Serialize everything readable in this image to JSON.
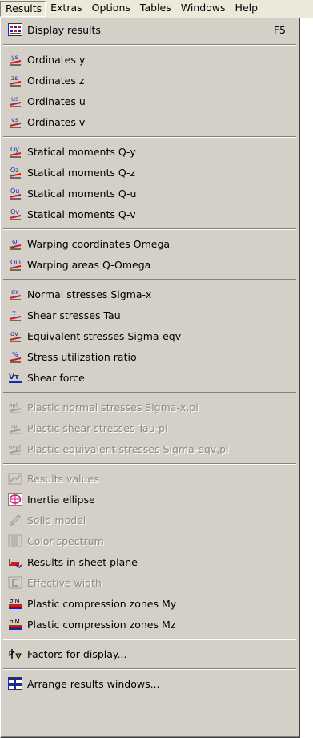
{
  "menubar": {
    "items": [
      "Results",
      "Extras",
      "Options",
      "Tables",
      "Windows",
      "Help"
    ]
  },
  "menu": {
    "items": [
      {
        "label": "Display results",
        "shortcut": "F5",
        "icon": "display-results-icon"
      },
      {
        "label": "Ordinates y",
        "icon": "ordinate-y-icon"
      },
      {
        "label": "Ordinates z",
        "icon": "ordinate-z-icon"
      },
      {
        "label": "Ordinates u",
        "icon": "ordinate-u-icon"
      },
      {
        "label": "Ordinates v",
        "icon": "ordinate-v-icon"
      },
      {
        "label": "Statical moments Q-y",
        "icon": "statical-moment-y-icon"
      },
      {
        "label": "Statical moments Q-z",
        "icon": "statical-moment-z-icon"
      },
      {
        "label": "Statical moments Q-u",
        "icon": "statical-moment-u-icon"
      },
      {
        "label": "Statical moments Q-v",
        "icon": "statical-moment-v-icon"
      },
      {
        "label": "Warping coordinates Omega",
        "icon": "warping-coordinates-icon"
      },
      {
        "label": "Warping areas Q-Omega",
        "icon": "warping-areas-icon"
      },
      {
        "label": "Normal stresses Sigma-x",
        "icon": "normal-stress-icon"
      },
      {
        "label": "Shear stresses Tau",
        "icon": "shear-stress-icon"
      },
      {
        "label": "Equivalent stresses Sigma-eqv",
        "icon": "equivalent-stress-icon"
      },
      {
        "label": "Stress utilization ratio",
        "icon": "stress-ratio-icon"
      },
      {
        "label": "Shear force",
        "icon": "shear-force-icon"
      },
      {
        "label": "Plastic normal stresses Sigma-x,pl",
        "icon": "plastic-normal-stress-icon",
        "disabled": true
      },
      {
        "label": "Plastic shear stresses Tau-pl",
        "icon": "plastic-shear-stress-icon",
        "disabled": true
      },
      {
        "label": "Plastic equivalent stresses  Sigma-eqv,pl",
        "icon": "plastic-equivalent-stress-icon",
        "disabled": true
      },
      {
        "label": "Results values",
        "icon": "results-values-icon",
        "disabled": true
      },
      {
        "label": "Inertia ellipse",
        "icon": "inertia-ellipse-icon"
      },
      {
        "label": "Solid model",
        "icon": "solid-model-icon",
        "disabled": true
      },
      {
        "label": "Color spectrum",
        "icon": "color-spectrum-icon",
        "disabled": true
      },
      {
        "label": "Results in sheet plane",
        "icon": "sheet-plane-icon"
      },
      {
        "label": "Effective width",
        "icon": "effective-width-icon",
        "disabled": true
      },
      {
        "label": "Plastic compression zones My",
        "icon": "compression-zone-my-icon"
      },
      {
        "label": "Plastic compression zones Mz",
        "icon": "compression-zone-mz-icon"
      },
      {
        "label": "Factors for display...",
        "icon": "factors-icon"
      },
      {
        "label": "Arrange results windows...",
        "icon": "arrange-windows-icon"
      }
    ]
  },
  "colors": {
    "menu_bg": "#d4d0c8",
    "menubar_bg": "#ece9d8",
    "icon_red": "#c81e1e",
    "icon_blue": "#1a2a9c",
    "disabled_text": "#8c8a85"
  }
}
